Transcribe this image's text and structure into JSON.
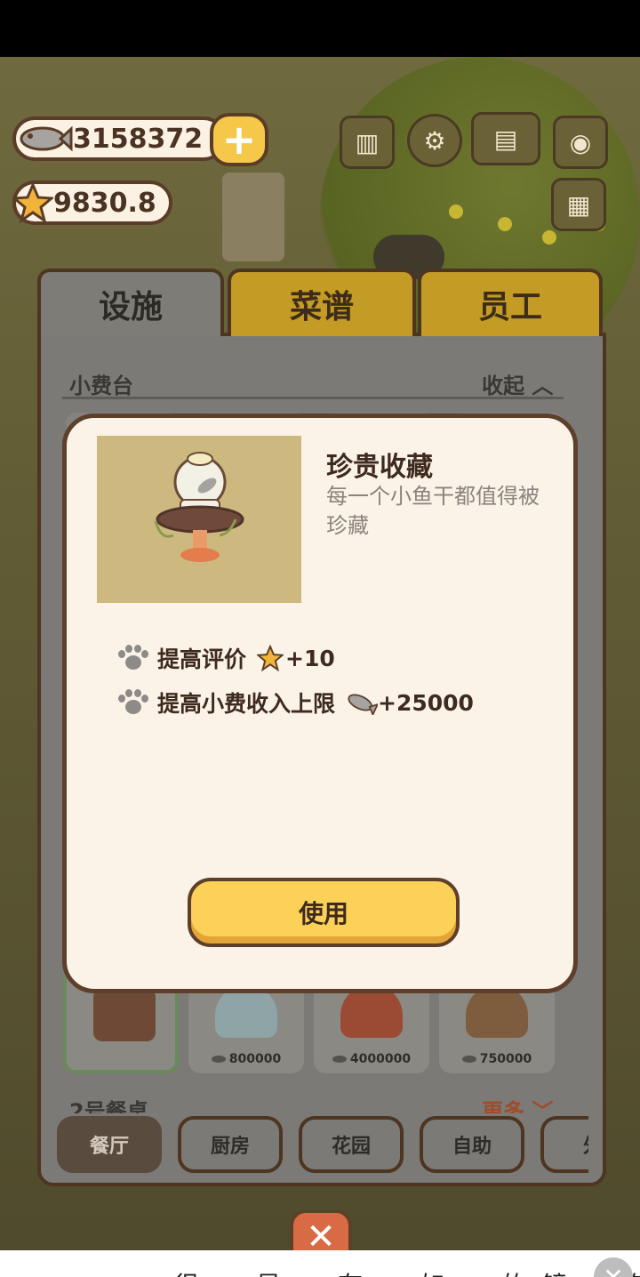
{
  "hud": {
    "fish_currency": "3158372",
    "star_rating": "9830.8",
    "add_button": "+"
  },
  "tabs": [
    {
      "label": "设施",
      "active": true
    },
    {
      "label": "菜谱",
      "active": false
    },
    {
      "label": "员工",
      "active": false
    }
  ],
  "section": {
    "title": "小费台",
    "collapse_label": "收起",
    "next_title": "2号餐桌",
    "more_label": "更多"
  },
  "furniture_cards": [
    {
      "price": "",
      "selected": true
    },
    {
      "price": "800000",
      "selected": false
    },
    {
      "price": "4000000",
      "selected": false
    },
    {
      "price": "750000",
      "selected": false
    }
  ],
  "categories": [
    {
      "label": "餐厅",
      "active": true
    },
    {
      "label": "厨房",
      "active": false
    },
    {
      "label": "花园",
      "active": false
    },
    {
      "label": "自助",
      "active": false
    },
    {
      "label": "外",
      "active": false
    }
  ],
  "modal": {
    "item_name": "珍贵收藏",
    "item_description": "每一个小鱼干都值得被珍藏",
    "effects": [
      {
        "label": "提高评价",
        "value": "+10",
        "icon": "star-icon"
      },
      {
        "label": "提高小费收入上限",
        "value": "+25000",
        "icon": "fish-icon"
      }
    ],
    "use_button": "使用"
  },
  "close_button": "✕",
  "caption": "…很…星…存…如…的镜…有我"
}
